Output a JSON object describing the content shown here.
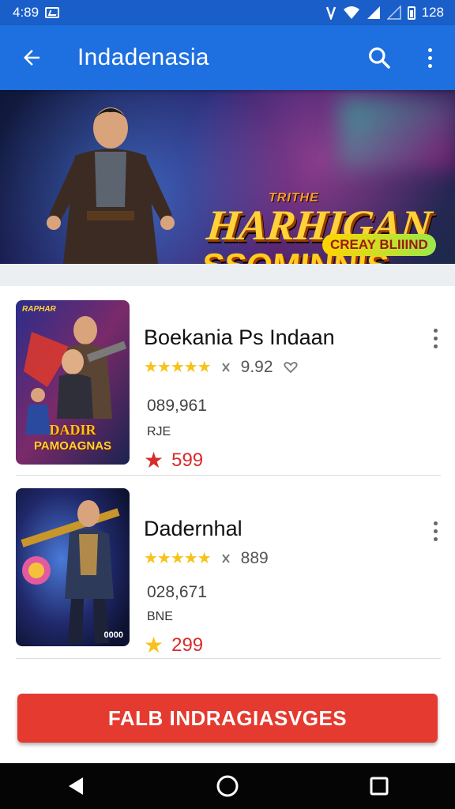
{
  "status_bar": {
    "time": "4:89",
    "battery_text": "128",
    "icons": [
      "notification-icon",
      "vibrate-icon",
      "wifi-icon",
      "signal-icon",
      "signal-icon",
      "battery-icon"
    ]
  },
  "app_bar": {
    "title": "Indadenasia",
    "icons": [
      "back-arrow-icon",
      "search-icon",
      "more-vert-icon"
    ],
    "color": "#1e6fe0"
  },
  "banner": {
    "kicker": "TRITHE",
    "title_line1": "HARHIGAN",
    "title_line2": "SSOMINNIS",
    "badge": "CREAY BLIIIND",
    "slide_count": 2,
    "active_slide": 1
  },
  "items": [
    {
      "name": "Boekania Ps Indaan",
      "rating_stars": 5,
      "rating_value": "9.92",
      "downloads": "089,961",
      "size": "RJE",
      "price": "599",
      "price_icon_color": "#d82b2b",
      "thumb_title_top": "DADIR",
      "thumb_title_bottom": "PAMOAGNAS",
      "thumb_badge": "RAPHAR"
    },
    {
      "name": "Dadernhal",
      "rating_stars": 5,
      "rating_value": "889",
      "downloads": "028,671",
      "size": "BNE",
      "price": "299",
      "price_icon_color": "#f7c21a",
      "thumb_badge": "0000"
    }
  ],
  "cta": {
    "label": "FALB INDRAGIASVGES",
    "color": "#e53a2f"
  },
  "nav_bar": {
    "icons": [
      "back-triangle-icon",
      "home-circle-icon",
      "recents-square-icon"
    ]
  }
}
